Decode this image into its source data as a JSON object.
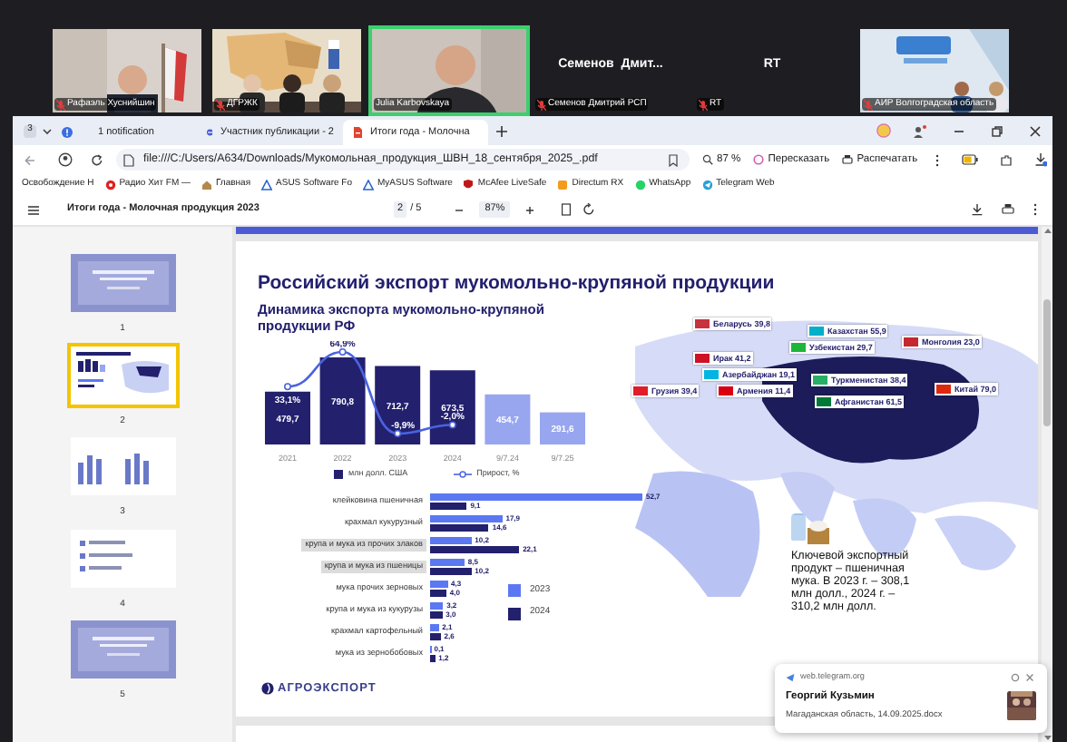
{
  "video_tiles": [
    {
      "kind": "video",
      "label": "Рафаэль Хуснийшин",
      "muted": true,
      "speaking": false
    },
    {
      "kind": "video",
      "label": "ДГРЖК",
      "muted": true,
      "speaking": false
    },
    {
      "kind": "video",
      "label": "Julia Karbovskaya",
      "muted": false,
      "speaking": true
    },
    {
      "kind": "name",
      "name": "Семенов  Дмит...",
      "label": "Семенов Дмитрий РСП",
      "muted": true,
      "speaking": false
    },
    {
      "kind": "name",
      "name": "RT",
      "label": "RT",
      "muted": true,
      "speaking": false
    },
    {
      "kind": "video",
      "label": "АИР Волгоградская область",
      "muted": true,
      "speaking": false
    }
  ],
  "browser": {
    "tab_count": "3",
    "tabs": [
      {
        "kind": "notification",
        "label": "1 notification",
        "selected": false
      },
      {
        "kind": "site",
        "label": "Участник публикации - 2",
        "selected": false
      },
      {
        "kind": "pdf",
        "label": "Итоги года - Молочна",
        "selected": true
      }
    ],
    "url": "file:///C:/Users/A634/Downloads/Мукомольная_продукция_ШВН_18_сентября_2025_.pdf",
    "zoom": "87 %",
    "toolbar_buttons": [
      {
        "kind": "retell",
        "label": "Пересказать"
      },
      {
        "kind": "print",
        "label": "Распечатать"
      }
    ],
    "bookmarks": [
      {
        "kind": "text",
        "label": "Освобождение Н"
      },
      {
        "kind": "radio",
        "label": "Радио Хит FM — "
      },
      {
        "kind": "home",
        "label": "Главная"
      },
      {
        "kind": "asus",
        "label": "ASUS Software Fo"
      },
      {
        "kind": "asus",
        "label": "MyASUS Software"
      },
      {
        "kind": "mcafee",
        "label": "McAfee LiveSafe"
      },
      {
        "kind": "directum",
        "label": "Directum RX"
      },
      {
        "kind": "whatsapp",
        "label": "WhatsApp"
      },
      {
        "kind": "telegram",
        "label": "Telegram Web"
      }
    ]
  },
  "pdf_viewer": {
    "title": "Итоги года - Молочная продукция 2023",
    "page": "2",
    "total": "/ 5",
    "zoom": "87%",
    "thumbnails": [
      {
        "number": "1",
        "selected": false,
        "kind": "cover"
      },
      {
        "number": "2",
        "selected": true,
        "kind": "map"
      },
      {
        "number": "3",
        "selected": false,
        "kind": "bars"
      },
      {
        "number": "4",
        "selected": false,
        "kind": "list"
      },
      {
        "number": "5",
        "selected": false,
        "kind": "cover"
      }
    ]
  },
  "slide": {
    "title": "Российский экспорт мукомольно-крупяной продукции",
    "subtitle": "Динамика экспорта мукомольно-крупяной продукции РФ",
    "export_chart": {
      "chart_data": {
        "type": "bar",
        "stacked": true,
        "legend": "bottom",
        "categories": [
          "2021",
          "2022",
          "2023",
          "2024",
          "9/7.24",
          "9/7.25"
        ],
        "series": [
          {
            "name": "млн долл. США",
            "color": "#23206e",
            "values": [
              479.7,
              790.8,
              712.7,
              673.5,
              null,
              null
            ],
            "value_labels": [
              "479,7",
              "790,8",
              "712,7",
              "673,5",
              null,
              null
            ]
          },
          {
            "color": "#98a6f0",
            "values": [
              null,
              null,
              null,
              null,
              454.7,
              291.6
            ],
            "value_labels": [
              null,
              null,
              null,
              null,
              "454,7",
              "291,6"
            ]
          }
        ],
        "data_labels": true
      },
      "growth_chart": {
        "chart_data": {
          "type": "line",
          "series": [
            {
              "name": "Прирост, %",
              "color": "#4a63e0",
              "marker": "o",
              "values": [
                33.1,
                64.9,
                -9.9,
                -2.0
              ],
              "value_labels": [
                "33,1%",
                "64,9%",
                "-9,9%",
                "-2,0%"
              ]
            }
          ],
          "data_labels": true
        }
      }
    },
    "product_chart": {
      "highlighted": [
        false,
        false,
        true,
        true,
        false,
        false,
        false,
        false
      ],
      "chart_data": {
        "type": "bar",
        "orientation": "horizontal",
        "legend": "right",
        "data_labels": true,
        "categories": [
          "клейковина пшеничная",
          "крахмал кукурузный",
          "крупа и мука из прочих злаков",
          "крупа и мука из пшеницы",
          "мука прочих зерновых",
          "крупа и мука из кукурузы",
          "крахмал картофельный",
          "мука из зернобобовых"
        ],
        "series": [
          {
            "name": "2023",
            "color": "#5b78f2",
            "values": [
              52.7,
              17.9,
              10.2,
              8.5,
              4.3,
              3.2,
              2.1,
              0.1
            ],
            "value_labels": [
              "52,7",
              "17,9",
              "10,2",
              "8,5",
              "4,3",
              "3,2",
              "2,1",
              "0,1"
            ]
          },
          {
            "name": "2024",
            "color": "#23206e",
            "values": [
              9.1,
              14.6,
              22.1,
              10.2,
              4.0,
              3.0,
              2.6,
              1.2
            ],
            "value_labels": [
              "9,1",
              "14,6",
              "22,1",
              "10,2",
              "4,0",
              "3,0",
              "2,6",
              "1,2"
            ]
          }
        ]
      }
    },
    "map_labels": [
      {
        "country": "Беларусь",
        "value": "39,8",
        "color": "#c8313e"
      },
      {
        "country": "Казахстан",
        "value": "55,9",
        "color": "#00afca"
      },
      {
        "country": "Ирак",
        "value": "41,2",
        "color": "#ce1126"
      },
      {
        "country": "Узбекистан",
        "value": "29,7",
        "color": "#1eb53a"
      },
      {
        "country": "Монголия",
        "value": "23,0",
        "color": "#c4272f"
      },
      {
        "country": "Азербайджан",
        "value": "19,1",
        "color": "#00b5e2"
      },
      {
        "country": "Туркменистан",
        "value": "38,4",
        "color": "#28ae66"
      },
      {
        "country": "Грузия",
        "value": "39,4",
        "color": "#e01e2a"
      },
      {
        "country": "Армения",
        "value": "11,4",
        "color": "#d90012"
      },
      {
        "country": "Китай",
        "value": "79,0",
        "color": "#de2910"
      },
      {
        "country": "Афганистан",
        "value": "61,5",
        "color": "#007a36"
      }
    ],
    "key_fact": "Ключевой экспортный продукт – пшеничная мука. В 2023 г. – 308,1 млн долл., 2024 г. – 310,2 млн долл.",
    "logo": "АГРОЭКСПОРТ"
  },
  "notification": {
    "source": "web.telegram.org",
    "title": "Георгий Кузьмин",
    "text": "Магаданская область, 14.09.2025.docx"
  }
}
